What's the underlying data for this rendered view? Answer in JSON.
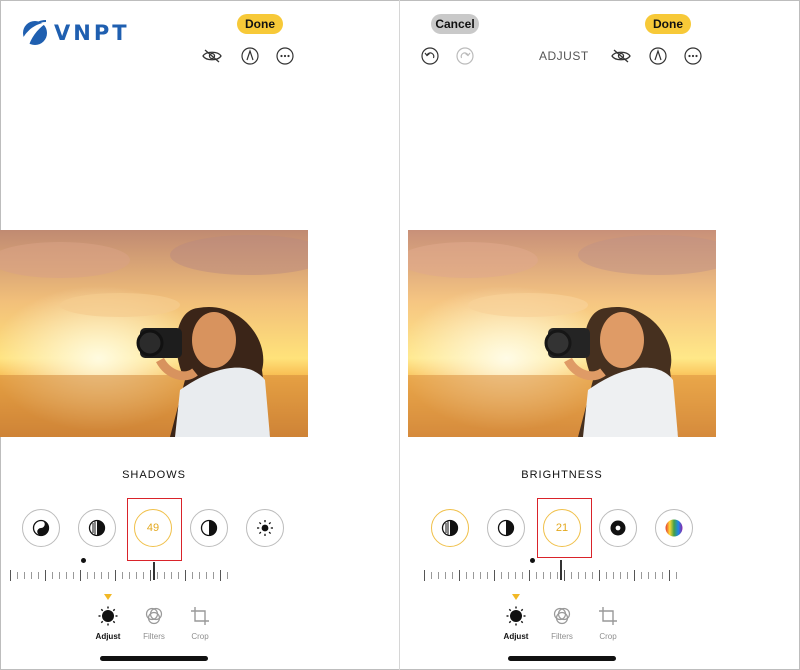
{
  "logo": {
    "text": "VNPT"
  },
  "left": {
    "header": {
      "done_label": "Done"
    },
    "tool_title": "SHADOWS",
    "active_value": "49",
    "tabs": [
      {
        "label": "Adjust",
        "selected": true
      },
      {
        "label": "Filters",
        "selected": false
      },
      {
        "label": "Crop",
        "selected": false
      }
    ]
  },
  "right": {
    "header": {
      "cancel_label": "Cancel",
      "done_label": "Done",
      "mode_label": "ADJUST"
    },
    "tool_title": "BRIGHTNESS",
    "active_value": "21",
    "tabs": [
      {
        "label": "Adjust",
        "selected": true
      },
      {
        "label": "Filters",
        "selected": false
      },
      {
        "label": "Crop",
        "selected": false
      }
    ]
  },
  "colors": {
    "accent_yellow": "#f7c938",
    "active_ring": "#f0c04a",
    "value_text": "#e3a81e",
    "highlight_red": "#d9232a",
    "logo_blue": "#1f5fb0"
  }
}
